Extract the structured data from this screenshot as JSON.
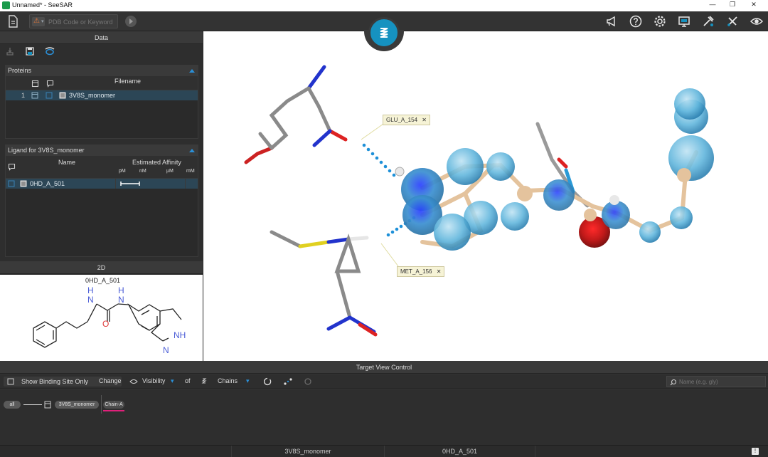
{
  "window": {
    "title": "Unnamed* - SeeSAR",
    "minimize": "—",
    "restore": "❐",
    "close": "✕"
  },
  "toolbar": {
    "search_placeholder": "PDB Code or Keyword",
    "warn_symbol": "⚠"
  },
  "data_panel": {
    "title": "Data",
    "proteins": {
      "title": "Proteins",
      "column_filename": "Filename",
      "rows": [
        {
          "index": "1",
          "filename": "3V8S_monomer"
        }
      ]
    },
    "ligand": {
      "title": "Ligand for 3V8S_monomer",
      "column_name": "Name",
      "column_affinity": "Estimated Affinity",
      "units": [
        "pM",
        "nM",
        "µM",
        "mM"
      ],
      "rows": [
        {
          "name": "0HD_A_501"
        }
      ]
    }
  },
  "panel_2d": {
    "title": "2D",
    "ligand_name": "0HD_A_501",
    "atom_labels": {
      "nh_left": "H",
      "n_left": "N",
      "nh_right": "H",
      "n_right": "N",
      "o": "O",
      "indazole_nh": "NH",
      "indazole_n": "N"
    }
  },
  "viewer": {
    "callouts": [
      {
        "label": "GLU_A_154",
        "close": "✕"
      },
      {
        "label": "MET_A_156",
        "close": "✕"
      }
    ]
  },
  "target_view_control": {
    "title": "Target View Control",
    "show_binding_site_only": "Show Binding Site Only",
    "change_label": "Change",
    "visibility_label": "Visibility",
    "of_label": "of",
    "chains_label": "Chains",
    "search_placeholder": "Name (e.g. gly)",
    "tree": {
      "all": "all",
      "protein": "3V8S_monomer",
      "chain": "Chain-A"
    }
  },
  "status_bar": {
    "protein": "3V8S_monomer",
    "ligand": "0HD_A_501",
    "notice": "!"
  },
  "colors": {
    "accent_blue": "#2b8fd6",
    "selection_row": "#2c4656",
    "chain_underline": "#e0207a",
    "logo": "#1692c0"
  }
}
